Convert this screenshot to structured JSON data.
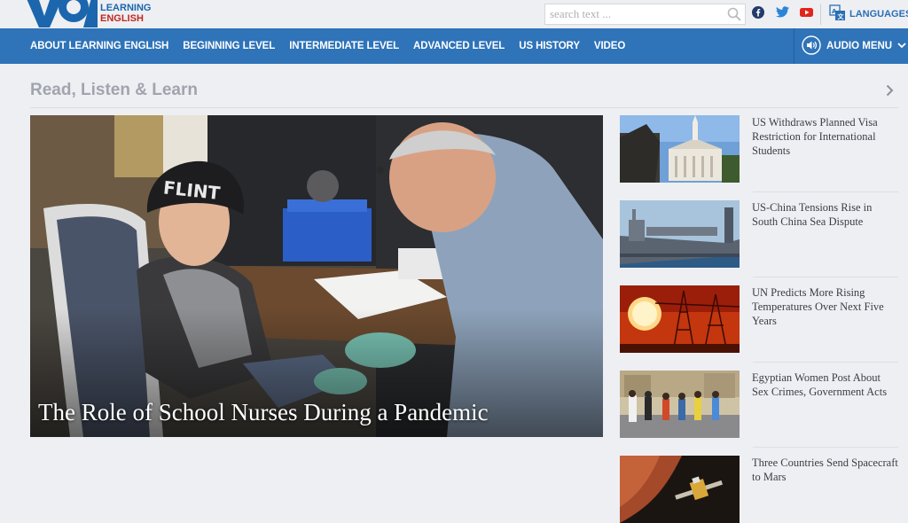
{
  "header": {
    "brand_line1": "LEARNING",
    "brand_line2": "ENGLISH",
    "search_placeholder": "search text ...",
    "languages_label": "LANGUAGES",
    "icons": [
      "search-icon",
      "facebook-icon",
      "twitter-icon",
      "youtube-icon",
      "languages-icon"
    ]
  },
  "nav": {
    "items": [
      {
        "label": "ABOUT LEARNING ENGLISH"
      },
      {
        "label": "BEGINNING LEVEL"
      },
      {
        "label": "INTERMEDIATE LEVEL"
      },
      {
        "label": "ADVANCED LEVEL"
      },
      {
        "label": "US HISTORY"
      },
      {
        "label": "VIDEO"
      }
    ],
    "audio_menu_label": "AUDIO MENU"
  },
  "section": {
    "title": "Read, Listen & Learn"
  },
  "hero": {
    "title": "The Role of School Nurses During a Pandemic"
  },
  "stories": [
    {
      "title": "US Withdraws Planned Visa Restriction for International Students"
    },
    {
      "title": "US-China Tensions Rise in South China Sea Dispute"
    },
    {
      "title": "UN Predicts More Rising Temperatures Over Next Five Years"
    },
    {
      "title": "Egyptian Women Post About Sex Crimes, Government Acts"
    },
    {
      "title": "Three Countries Send Spacecraft to Mars"
    }
  ],
  "colors": {
    "nav_background": "#2f73b8",
    "page_background": "#eeeff3",
    "brand_blue": "#1b66ad",
    "brand_red": "#c0281f"
  }
}
